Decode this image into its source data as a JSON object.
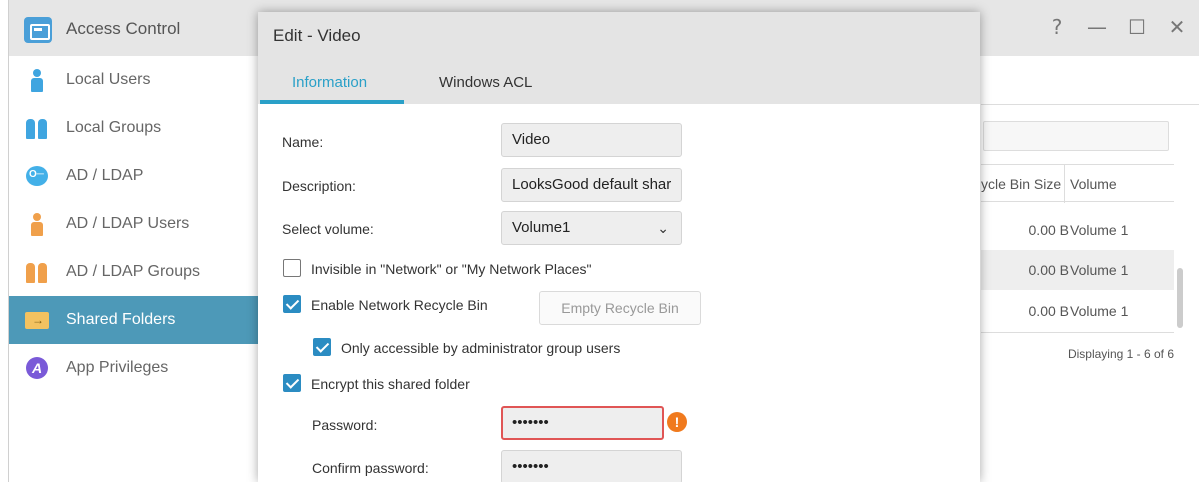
{
  "app": {
    "title": "Access Control",
    "window_controls": [
      "?",
      "—",
      "☐",
      "✕"
    ]
  },
  "sidebar": {
    "items": [
      {
        "label": "Local Users",
        "icon": "user-icon"
      },
      {
        "label": "Local Groups",
        "icon": "group-icon"
      },
      {
        "label": "AD / LDAP",
        "icon": "key-icon"
      },
      {
        "label": "AD / LDAP Users",
        "icon": "ad-user-icon"
      },
      {
        "label": "AD / LDAP Groups",
        "icon": "ad-group-icon"
      },
      {
        "label": "Shared Folders",
        "icon": "folder-icon",
        "active": true
      },
      {
        "label": "App Privileges",
        "icon": "app-privileges-icon"
      }
    ]
  },
  "background_table": {
    "headers": [
      "ycle Bin Size",
      "Volume"
    ],
    "rows": [
      {
        "size": "0.00 B",
        "volume": "Volume 1"
      },
      {
        "size": "0.00 B",
        "volume": "Volume 1"
      },
      {
        "size": "0.00 B",
        "volume": "Volume 1"
      }
    ],
    "footer": "Displaying 1 - 6 of 6"
  },
  "dialog": {
    "title": "Edit - Video",
    "tabs": [
      "Information",
      "Windows ACL"
    ],
    "active_tab": "Information",
    "name_label": "Name:",
    "name_value": "Video",
    "description_label": "Description:",
    "description_value": "LooksGood default shar",
    "volume_label": "Select volume:",
    "volume_value": "Volume1",
    "invisible_label": "Invisible in \"Network\" or \"My Network Places\"",
    "invisible_checked": false,
    "recycle_label": "Enable Network Recycle Bin",
    "recycle_checked": true,
    "empty_recycle_button": "Empty Recycle Bin",
    "admin_only_label": "Only accessible by administrator group users",
    "admin_only_checked": true,
    "encrypt_label": "Encrypt this shared folder",
    "encrypt_checked": true,
    "password_label": "Password:",
    "password_value": "•••••••",
    "confirm_label": "Confirm password:",
    "confirm_value": "•••••••",
    "warning_icon": "!",
    "accent_color": "#2aa0c8"
  }
}
